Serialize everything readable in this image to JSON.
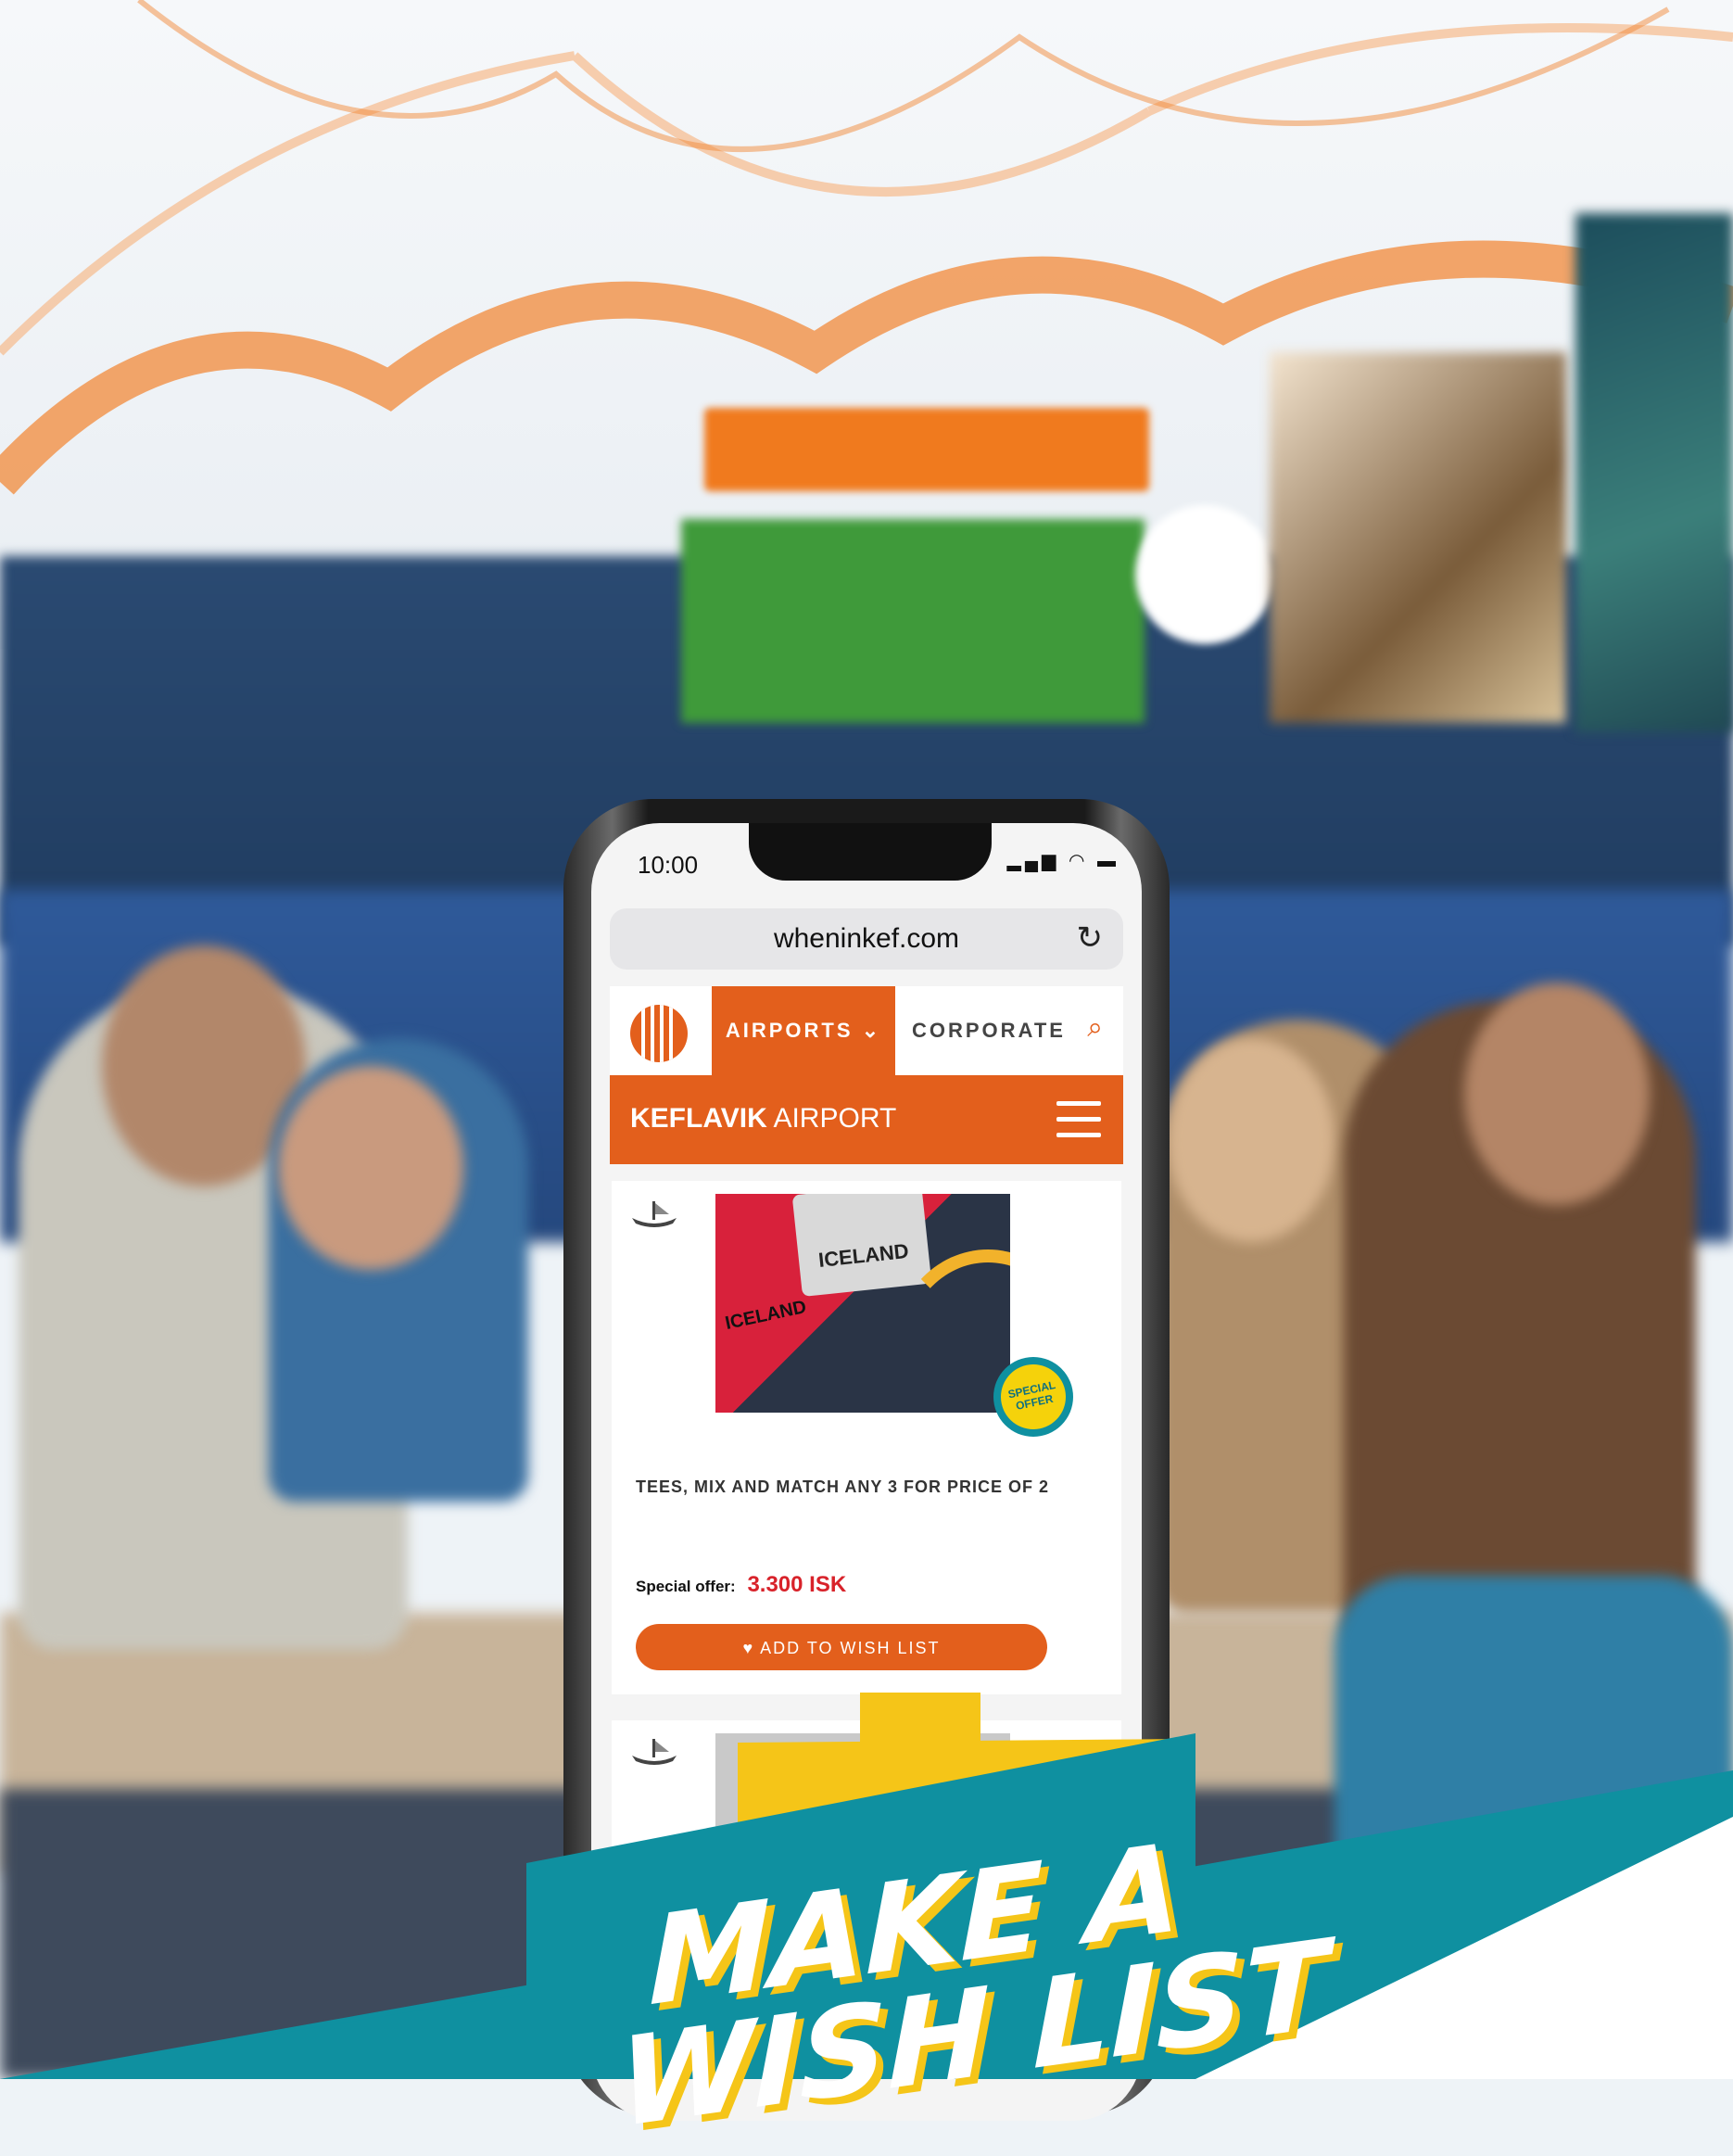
{
  "status_bar": {
    "time": "10:00"
  },
  "browser": {
    "url": "wheninkef.com"
  },
  "site_nav": {
    "airports_label": "AIRPORTS",
    "corporate_label": "CORPORATE"
  },
  "hero": {
    "title_bold": "KEFLAVIK",
    "title_rest": " AIRPORT"
  },
  "product": {
    "title": "TEES, MIX AND MATCH ANY 3 FOR PRICE OF 2",
    "offer_label": "Special offer:",
    "offer_price": "3.300 ISK",
    "wish_button": "ADD TO WISH LIST",
    "badge_line1": "SPECIAL",
    "badge_line2": "OFFER",
    "shirt_text": "ICELAND",
    "shirt_text2": "ICELAND"
  },
  "banner": {
    "line1": "MAKE A",
    "line2": "WISH LIST"
  },
  "colors": {
    "brand_orange": "#e35f1c",
    "teal": "#0f90a0",
    "yellow": "#f5c518"
  }
}
